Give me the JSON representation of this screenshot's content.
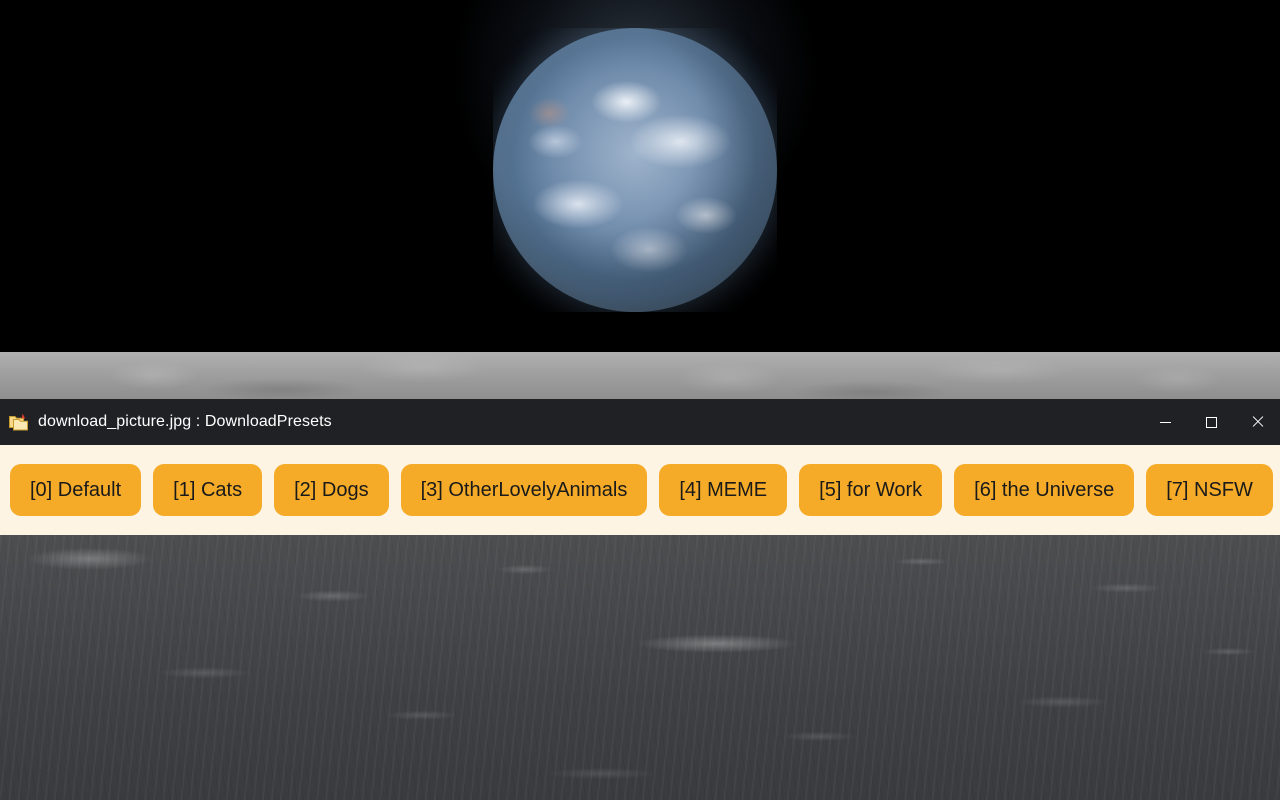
{
  "window": {
    "title": "download_picture.jpg : DownloadPresets",
    "icon": "folder-copy-icon",
    "controls": {
      "minimize": "minimize-button",
      "maximize": "maximize-button",
      "close": "close-button"
    }
  },
  "presets": {
    "buttons": [
      {
        "label": "[0] Default"
      },
      {
        "label": "[1] Cats"
      },
      {
        "label": "[2] Dogs"
      },
      {
        "label": "[3] OtherLovelyAnimals"
      },
      {
        "label": "[4] MEME"
      },
      {
        "label": "[5] for Work"
      },
      {
        "label": "[6] the Universe"
      },
      {
        "label": "[7] NSFW"
      }
    ]
  },
  "colors": {
    "titlebar_bg": "#202124",
    "titlebar_text": "#ffffff",
    "preset_bar_bg": "#fdf4e3",
    "preset_button_bg": "#f5ab27",
    "preset_button_text": "#1a1a1a"
  },
  "wallpaper": {
    "description": "Earthrise photograph: Earth rising over the lunar horizon against black space"
  }
}
